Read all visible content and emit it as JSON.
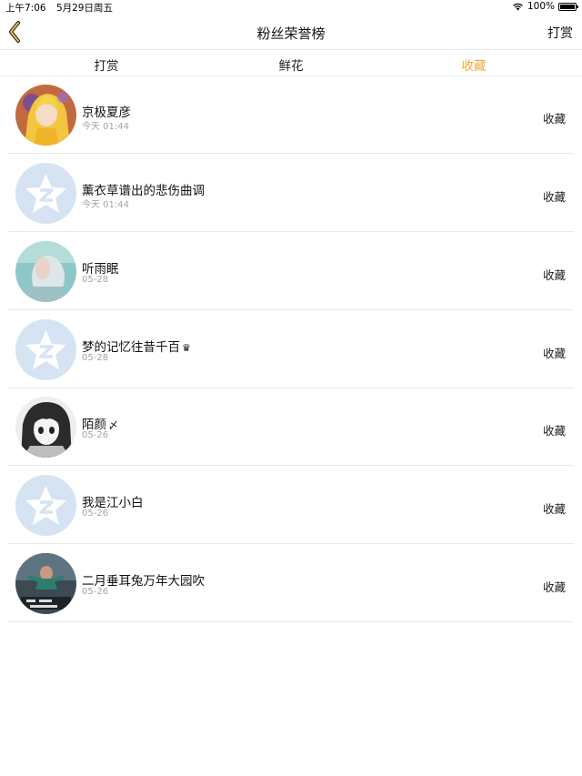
{
  "status": {
    "time": "上午7:06",
    "date": "5月29日周五",
    "battery": "100%"
  },
  "nav": {
    "title": "粉丝荣誉榜",
    "action": "打赏"
  },
  "tabs": [
    {
      "label": "打赏",
      "active": false
    },
    {
      "label": "鲜花",
      "active": false
    },
    {
      "label": "收藏",
      "active": true
    }
  ],
  "rows": [
    {
      "name": "京极夏彦",
      "badge": "",
      "time": "今天 01:44",
      "action": "收藏",
      "avatar": "anime-avatar"
    },
    {
      "name": "薰衣草谱出的悲伤曲调",
      "badge": "",
      "time": "今天 01:44",
      "action": "收藏",
      "avatar": "default-avatar"
    },
    {
      "name": "听雨眠",
      "badge": "",
      "time": "05-28",
      "action": "收藏",
      "avatar": "photo-avatar"
    },
    {
      "name": "梦的记忆往昔千百",
      "badge": "♛",
      "time": "05-28",
      "action": "收藏",
      "avatar": "default-avatar"
    },
    {
      "name": "陌颜",
      "badge": "〆",
      "time": "05-26",
      "action": "收藏",
      "avatar": "manga-avatar"
    },
    {
      "name": "我是江小白",
      "badge": "",
      "time": "05-26",
      "action": "收藏",
      "avatar": "default-avatar"
    },
    {
      "name": "二月垂耳兔万年大园吹",
      "badge": "",
      "time": "05-26",
      "action": "收藏",
      "avatar": "scene-avatar"
    }
  ],
  "colors": {
    "accent": "#f0a73a",
    "default_avatar_bg": "#d6e3f2"
  }
}
